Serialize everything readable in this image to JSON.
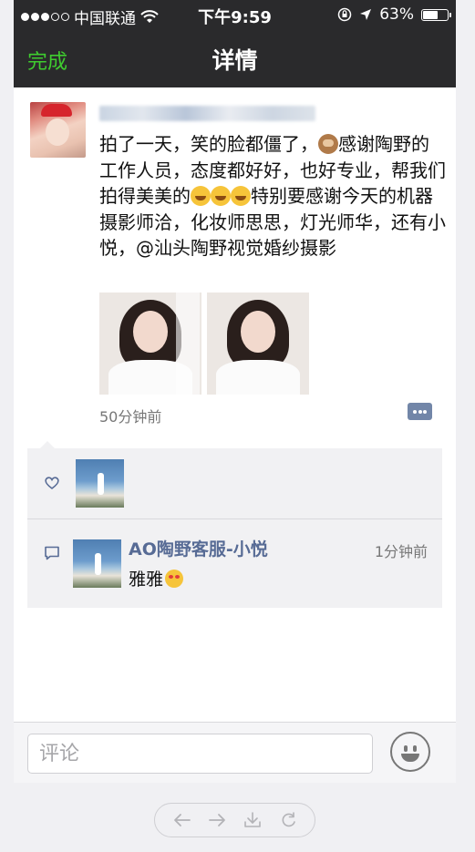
{
  "status_bar": {
    "carrier": "中国联通",
    "time": "下午9:59",
    "battery_percent": "63%",
    "battery_level": 0.63,
    "signal_dots_filled": 3,
    "signal_dots_total": 5,
    "icons": [
      "wifi-icon",
      "orientation-lock-icon",
      "location-arrow-icon",
      "battery-icon"
    ]
  },
  "nav": {
    "done_label": "完成",
    "title": "详情"
  },
  "post": {
    "text_segments": [
      "拍了一天，笑的脸都僵了，",
      "感谢陶野的工作人员，态度都好好，也好专业，帮我们拍得美美的",
      "特别要感谢今天的机器摄影师洽，化妆师思思，灯光师华，还有小悦，@汕头陶野视觉婚纱摄影"
    ],
    "emojis": [
      "see-no-evil-monkey-emoji",
      "laughing-emoji",
      "laughing-emoji",
      "laughing-emoji"
    ],
    "timestamp": "50分钟前",
    "photo_count": 2
  },
  "likes": {
    "icon": "heart-outline-icon",
    "liker_count": 1
  },
  "comments": [
    {
      "name": "AO陶野客服-小悦",
      "time": "1分钟前",
      "text": "雅雅",
      "emoji": "heart-eyes-emoji"
    }
  ],
  "comment_input": {
    "placeholder": "评论"
  },
  "colors": {
    "nav_bg": "#2a2a2c",
    "done_green": "#3fcc2f",
    "link_blue": "#576b95",
    "interaction_bg": "#f1f1f3"
  },
  "browser_toolbar": {
    "icons": [
      "back-arrow-icon",
      "forward-arrow-icon",
      "download-icon",
      "refresh-icon"
    ]
  }
}
